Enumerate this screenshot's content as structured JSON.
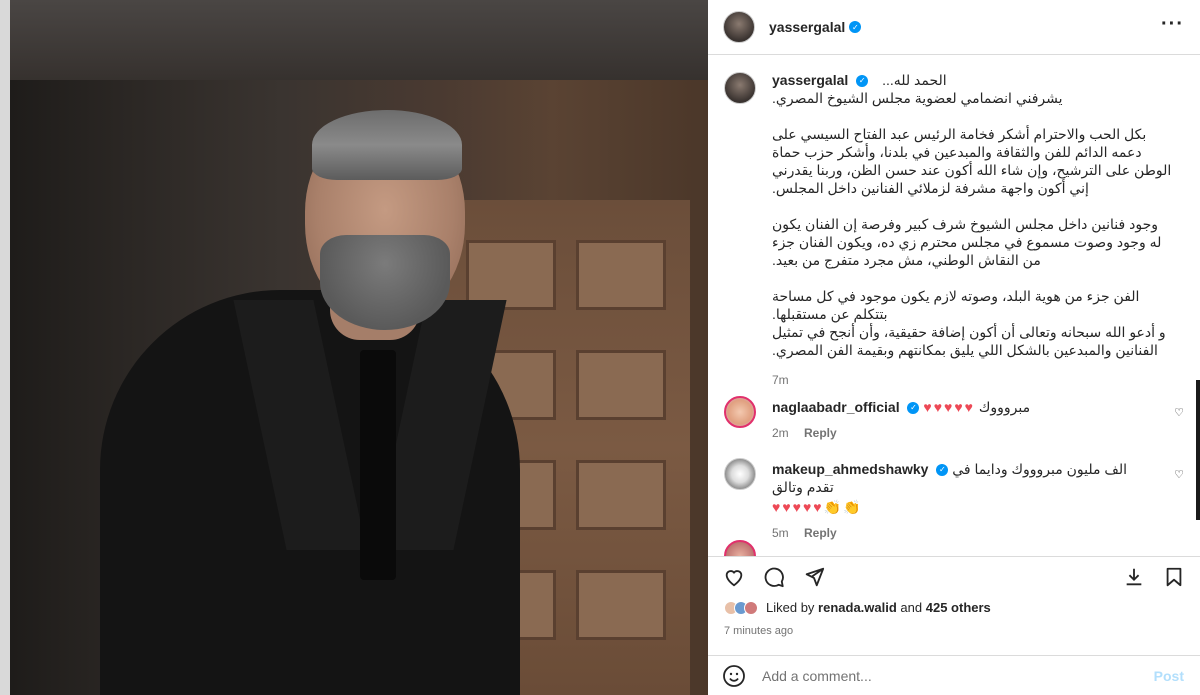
{
  "post": {
    "username": "yassergalal",
    "caption": {
      "first_line": "الحمد لله...",
      "paragraphs": [
        "يشرفني انضمامي لعضوية مجلس الشيوخ المصري.",
        "بكل الحب والاحترام أشكر فخامة الرئيس عبد الفتاح السيسي على دعمه الدائم للفن والثقافة والمبدعين في بلدنا، وأشكر حزب حماة الوطن على الترشيح، وإن شاء الله أكون عند حسن الظن، وربنا يقدرني إني أكون واجهة مشرفة لزملائي الفنانين داخل المجلس.",
        "وجود فنانين داخل مجلس الشيوخ شرف كبير وفرصة إن الفنان يكون له وجود وصوت مسموع في مجلس محترم زي ده، ويكون الفنان جزء من النقاش الوطني، مش مجرد متفرج من بعيد.",
        "الفن جزء من هوية البلد، وصوته لازم يكون موجود في كل مساحة بتتكلم عن مستقبلها.\nو أدعو الله سبحانه وتعالى أن أكون إضافة حقيقية، وأن أنجح في تمثيل الفنانين والمبدعين بالشكل اللي يليق بمكانتهم وبقيمة الفن المصري."
      ],
      "time": "7m"
    },
    "comments": [
      {
        "username": "naglaabadr_official",
        "text": "مبروووك",
        "emoji": "♥♥♥♥♥",
        "time": "2m",
        "reply": "Reply"
      },
      {
        "username": "makeup_ahmedshawky",
        "text": "الف مليون مبروووك ودايما في تقدم وتالق",
        "emoji": "♥♥♥♥♥👏👏",
        "time": "5m",
        "reply": "Reply"
      }
    ],
    "likes": {
      "prefix": "Liked by",
      "user": "renada.walid",
      "and": "and",
      "others": "425 others"
    },
    "posted_time": "7 minutes ago",
    "comment_box": {
      "placeholder": "Add a comment...",
      "post_label": "Post"
    },
    "colors": {
      "accent": "#0095f6",
      "heart": "#ed4956",
      "post_disabled": "#b2dffc"
    }
  }
}
